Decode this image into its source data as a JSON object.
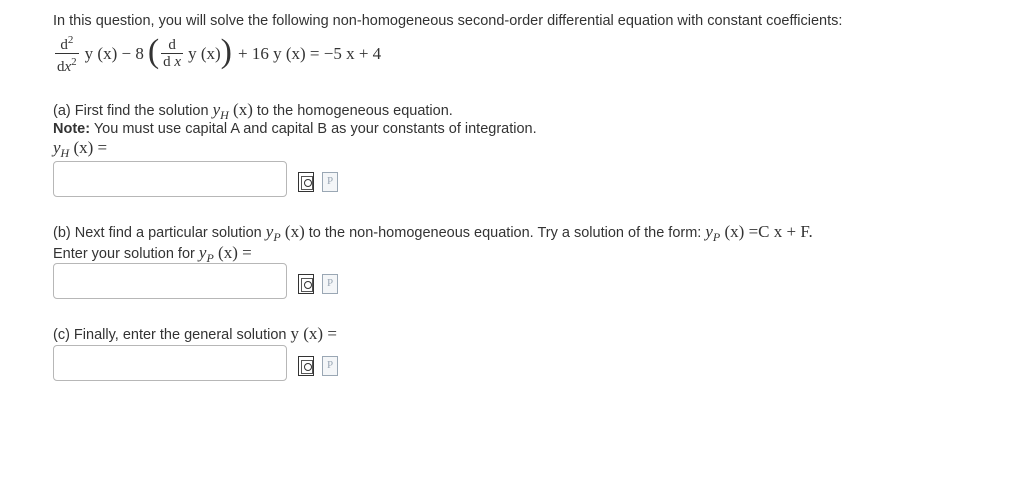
{
  "intro": "In this question, you will solve the following non-homogeneous second-order differential equation with constant coefficients:",
  "equation": {
    "d2": "d",
    "d2_exp": "2",
    "dx2_den": "d",
    "dx2_x": "x",
    "dx2_exp": "2",
    "term1": "y (x) − 8",
    "d1_num": "d",
    "d1_den_d": "d",
    "d1_den_x": "x",
    "term2": "y (x)",
    "rhs": "+ 16 y (x) = −5 x + 4"
  },
  "part_a": {
    "text": "(a) First find the solution",
    "yh_y": "y",
    "yh_sub": "H",
    "yh_x": "(x)",
    "text2": "to the homogeneous equation.",
    "note_label": "Note:",
    "note_text": "You must use capital A and capital B as your constants of integration.",
    "answer_label_y": "y",
    "answer_label_sub": "H",
    "answer_label_rest": "(x) ="
  },
  "part_b": {
    "text": "(b) Next find a particular solution",
    "yp_y": "y",
    "yp_sub": "P",
    "yp_x": "(x)",
    "text2": "to the non-homogeneous equation. Try a solution of the form:",
    "form_y": "y",
    "form_sub": "P",
    "form_rest": "(x) =C x + F.",
    "enter_text": "Enter your solution for",
    "enter_y": "y",
    "enter_sub": "P",
    "enter_rest": "(x) ="
  },
  "part_c": {
    "text": "(c) Finally, enter the general solution",
    "y_label": "y (x) ="
  },
  "icons": {
    "preview": "preview-document-icon",
    "p": "P"
  }
}
